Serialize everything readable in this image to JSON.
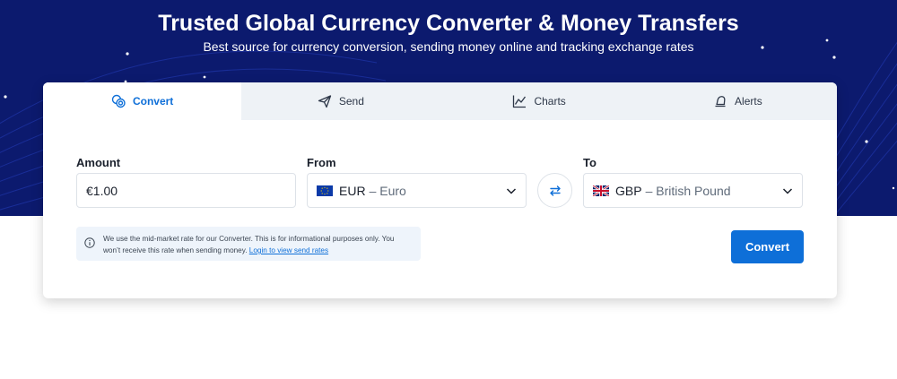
{
  "hero": {
    "title": "Trusted Global Currency Converter & Money Transfers",
    "subtitle": "Best source for currency conversion, sending money online and tracking exchange rates"
  },
  "tabs": [
    {
      "label": "Convert",
      "icon": "coins-icon",
      "active": true
    },
    {
      "label": "Send",
      "icon": "paper-plane-icon",
      "active": false
    },
    {
      "label": "Charts",
      "icon": "line-chart-icon",
      "active": false
    },
    {
      "label": "Alerts",
      "icon": "bell-icon",
      "active": false
    }
  ],
  "form": {
    "amount_label": "Amount",
    "amount_value": "€1.00",
    "from_label": "From",
    "from_code": "EUR",
    "from_name": "– Euro",
    "to_label": "To",
    "to_code": "GBP",
    "to_name": "– British Pound"
  },
  "notice": {
    "text": "We use the mid-market rate for our Converter. This is for informational purposes only. You won’t receive this rate when sending money.",
    "link": "Login to view send rates"
  },
  "convert_button": "Convert",
  "colors": {
    "hero_bg": "#0c1a6e",
    "accent": "#0e6fd8",
    "tab_bar": "#eef2f6",
    "notice_bg": "#eef4fb"
  }
}
